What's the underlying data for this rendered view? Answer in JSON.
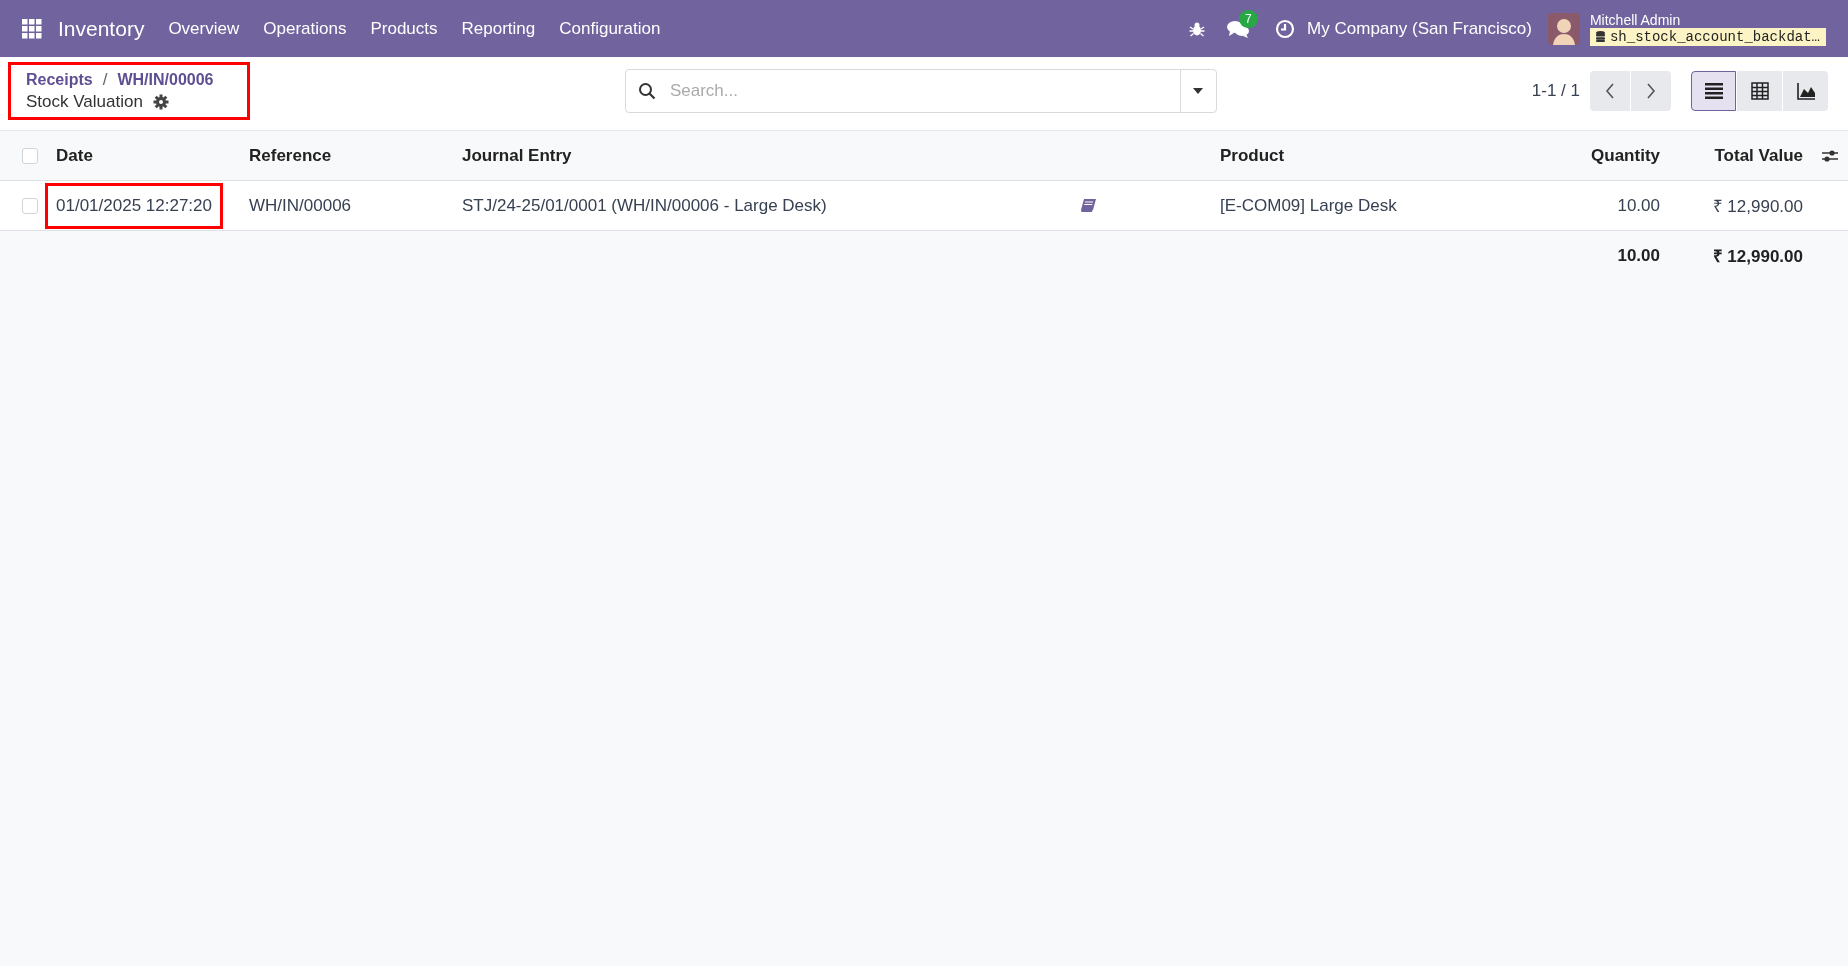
{
  "navbar": {
    "app": "Inventory",
    "menu": [
      "Overview",
      "Operations",
      "Products",
      "Reporting",
      "Configuration"
    ],
    "chat_count": "7",
    "company": "My Company (San Francisco)",
    "user": "Mitchell Admin",
    "database": "sh_stock_account_backdat…"
  },
  "breadcrumb": {
    "highlighted": true,
    "separator": "/",
    "items": [
      "Receipts",
      "WH/IN/00006"
    ],
    "title": "Stock Valuation"
  },
  "search": {
    "placeholder": "Search..."
  },
  "pager": "1-1 / 1",
  "views": [
    {
      "kind": "list",
      "selected": true
    },
    {
      "kind": "pivot",
      "selected": false
    },
    {
      "kind": "graph",
      "selected": false
    }
  ],
  "table": {
    "all_checked": false,
    "columns": [
      "Date",
      "Reference",
      "Journal Entry",
      "Product",
      "Quantity",
      "Total Value"
    ],
    "rows": [
      {
        "checked": false,
        "date": "01/01/2025 12:27:20",
        "date_highlighted": true,
        "reference": "WH/IN/00006",
        "journal_entry": "STJ/24-25/01/0001 (WH/IN/00006 - Large Desk)",
        "product": "[E-COM09] Large Desk",
        "quantity": "10.00",
        "total_value": "₹ 12,990.00"
      }
    ],
    "totals": {
      "quantity": "10.00",
      "total_value": "₹ 12,990.00"
    }
  }
}
